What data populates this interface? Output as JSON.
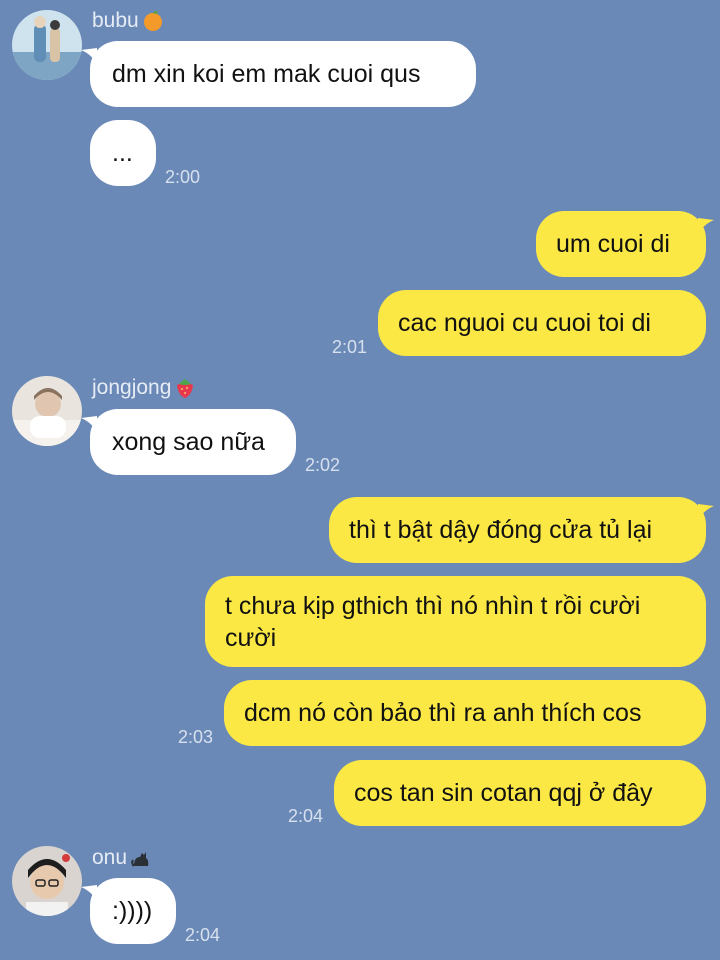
{
  "theme": {
    "background": "#6a89b7",
    "incoming_bubble": "#ffffff",
    "outgoing_bubble": "#fbe845"
  },
  "messages": [
    {
      "sender": "bubu",
      "sender_emoji": "orange",
      "text": "dm xin koi em mak cuoi qus"
    },
    {
      "text": "...",
      "time": "2:00"
    },
    {
      "text": "um cuoi di"
    },
    {
      "text": "cac nguoi cu cuoi toi di",
      "time": "2:01"
    },
    {
      "sender": "jongjong",
      "sender_emoji": "strawberry",
      "text": "xong sao nữa",
      "time": "2:02"
    },
    {
      "text": "thì t bật dậy đóng cửa tủ lại"
    },
    {
      "text_line1": "t chưa kịp gthich thì nó nhìn t rồi cười",
      "text_line2": "cười"
    },
    {
      "text": "dcm nó còn bảo thì ra anh thích cos",
      "time": "2:03"
    },
    {
      "text": "cos tan sin cotan qqj ở đây",
      "time": "2:04"
    },
    {
      "sender": "onu",
      "sender_emoji": "black-cat",
      "text": ":))))",
      "time": "2:04"
    }
  ]
}
